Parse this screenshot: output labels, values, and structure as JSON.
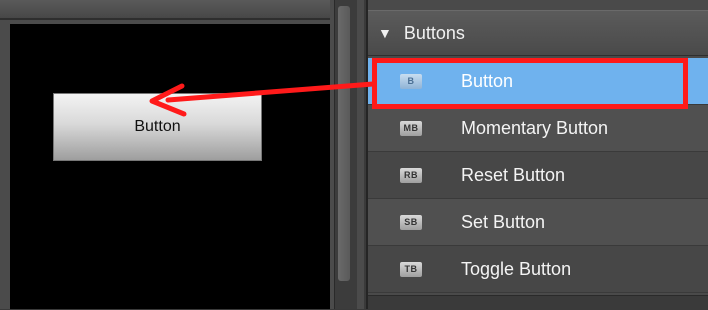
{
  "canvas": {
    "button_label": "Button"
  },
  "toolbox": {
    "group_title": "Buttons",
    "items": [
      {
        "badge": "B",
        "label": "Button"
      },
      {
        "badge": "MB",
        "label": "Momentary Button"
      },
      {
        "badge": "RB",
        "label": "Reset Button"
      },
      {
        "badge": "SB",
        "label": "Set Button"
      },
      {
        "badge": "TB",
        "label": "Toggle Button"
      }
    ]
  },
  "colors": {
    "selection": "#6fb2ee",
    "annotation": "#ff1a1a"
  }
}
